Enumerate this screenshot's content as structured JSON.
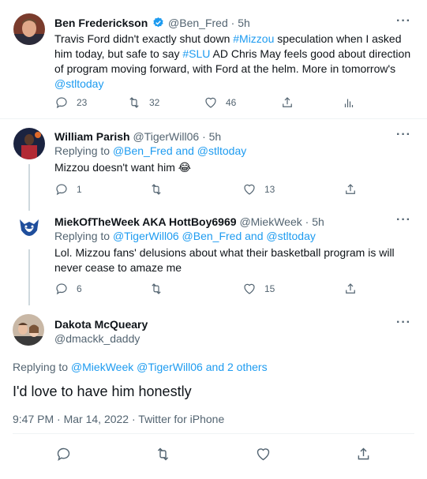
{
  "tweet1": {
    "name": "Ben Frederickson",
    "handle": "@Ben_Fred",
    "time": "5h",
    "more": "···",
    "text_parts": [
      "Travis Ford didn't exactly shut down ",
      "#Mizzou",
      " speculation when I asked him today, but safe to say ",
      "#SLU",
      " AD Chris May feels good about direction of program moving forward, with Ford at the helm. More in tomorrow's ",
      "@stltoday"
    ],
    "replies": "23",
    "retweets": "32",
    "likes": "46",
    "verified_color": "#1d9bf0"
  },
  "tweet2": {
    "name": "William Parish",
    "handle": "@TigerWill06",
    "time": "5h",
    "more": "···",
    "replying_label": "Replying to ",
    "replying_to_1": "@Ben_Fred",
    "replying_and": " and ",
    "replying_to_2": "@stltoday",
    "text": "Mizzou doesn't want him",
    "emoji": "😂",
    "replies": "1",
    "retweets": "",
    "likes": "13"
  },
  "tweet3": {
    "name": "MiekOfTheWeek AKA HottBoy6969",
    "handle": "@MiekWeek",
    "time": "5h",
    "more": "···",
    "replying_label": "Replying to ",
    "replying_to_1": "@TigerWill06",
    "replying_to_2": "@Ben_Fred",
    "replying_and": " and ",
    "replying_to_3": "@stltoday",
    "text": "Lol. Mizzou fans' delusions about what their basketball program is will never cease to amaze me",
    "replies": "6",
    "retweets": "",
    "likes": "15"
  },
  "main": {
    "name": "Dakota McQueary",
    "handle": "@dmackk_daddy",
    "more": "···",
    "replying_label": "Replying to ",
    "replying_to_1": "@MiekWeek",
    "replying_to_2": "@TigerWill06",
    "replying_and": " and ",
    "replying_others": "2 others",
    "text": "I'd love to have him honestly",
    "time": "9:47 PM",
    "date": "Mar 14, 2022",
    "source": "Twitter for iPhone",
    "sep": " · "
  },
  "colors": {
    "link": "#1d9bf0",
    "muted": "#536471",
    "text": "#0f1419"
  },
  "icons": {
    "reply": "speech-bubble",
    "retweet": "retweet-arrows",
    "like": "heart",
    "share": "upload-arrow",
    "analytics": "bar-chart",
    "verified": "verified-badge"
  }
}
